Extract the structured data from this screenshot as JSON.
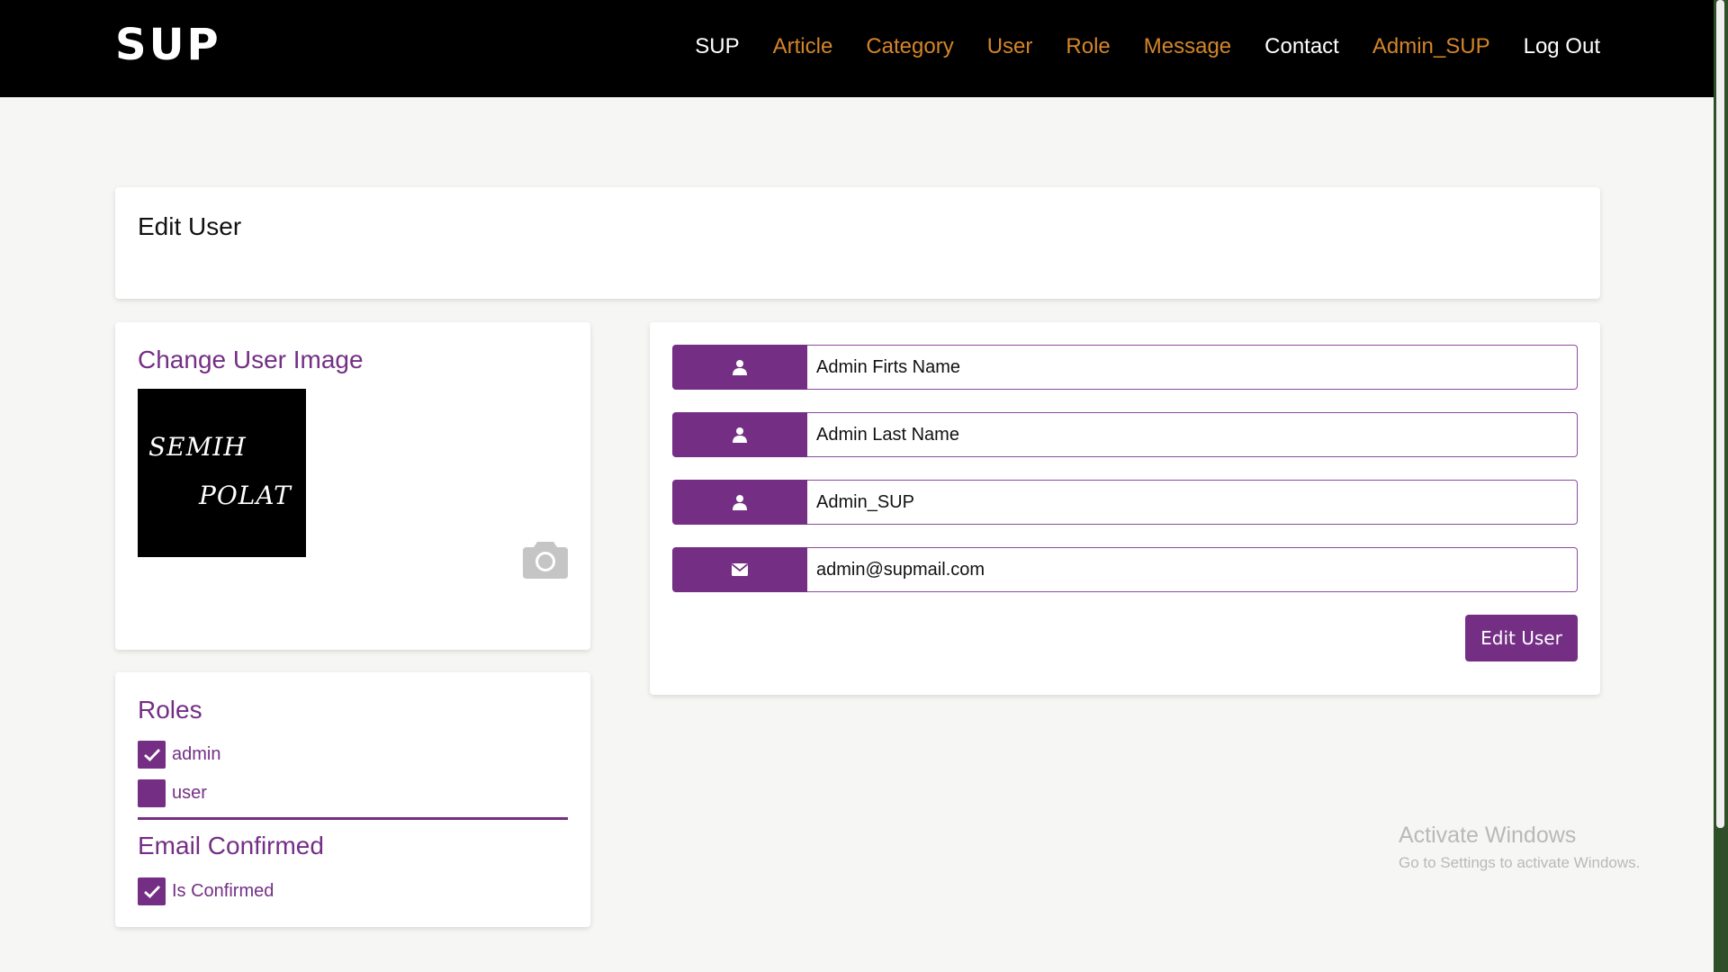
{
  "navbar": {
    "brand": "SUP",
    "links": [
      {
        "label": "SUP",
        "color": "#ffffff"
      },
      {
        "label": "Article",
        "color": "#d3852a"
      },
      {
        "label": "Category",
        "color": "#d3852a"
      },
      {
        "label": "User",
        "color": "#d3852a"
      },
      {
        "label": "Role",
        "color": "#d3852a"
      },
      {
        "label": "Message",
        "color": "#d3852a"
      },
      {
        "label": "Contact",
        "color": "#ffffff"
      },
      {
        "label": "Admin_SUP",
        "color": "#d3852a"
      },
      {
        "label": "Log Out",
        "color": "#ffffff"
      }
    ]
  },
  "page": {
    "title": "Edit User"
  },
  "image_card": {
    "heading": "Change User Image",
    "image_text": [
      "SEMIH",
      "POLAT"
    ],
    "camera_icon": "camera-icon"
  },
  "roles_card": {
    "heading": "Roles",
    "roles": [
      {
        "label": "admin",
        "checked": true
      },
      {
        "label": "user",
        "checked": false
      }
    ],
    "email_heading": "Email Confirmed",
    "email_confirmed": {
      "label": "Is Confirmed",
      "checked": true
    }
  },
  "form": {
    "first_name": {
      "value": "Admin Firts Name",
      "icon": "user-icon"
    },
    "last_name": {
      "value": "Admin Last Name",
      "icon": "user-icon"
    },
    "username": {
      "value": "Admin_SUP",
      "icon": "user-icon"
    },
    "email": {
      "value": "admin@supmail.com",
      "icon": "envelope-icon"
    },
    "submit_label": "Edit User"
  },
  "watermark": {
    "title": "Activate Windows",
    "subtitle": "Go to Settings to activate Windows."
  },
  "colors": {
    "accent": "#742f85",
    "nav_orange": "#d3852a",
    "navbar_bg": "#000000",
    "page_bg": "#f6f6f4"
  }
}
